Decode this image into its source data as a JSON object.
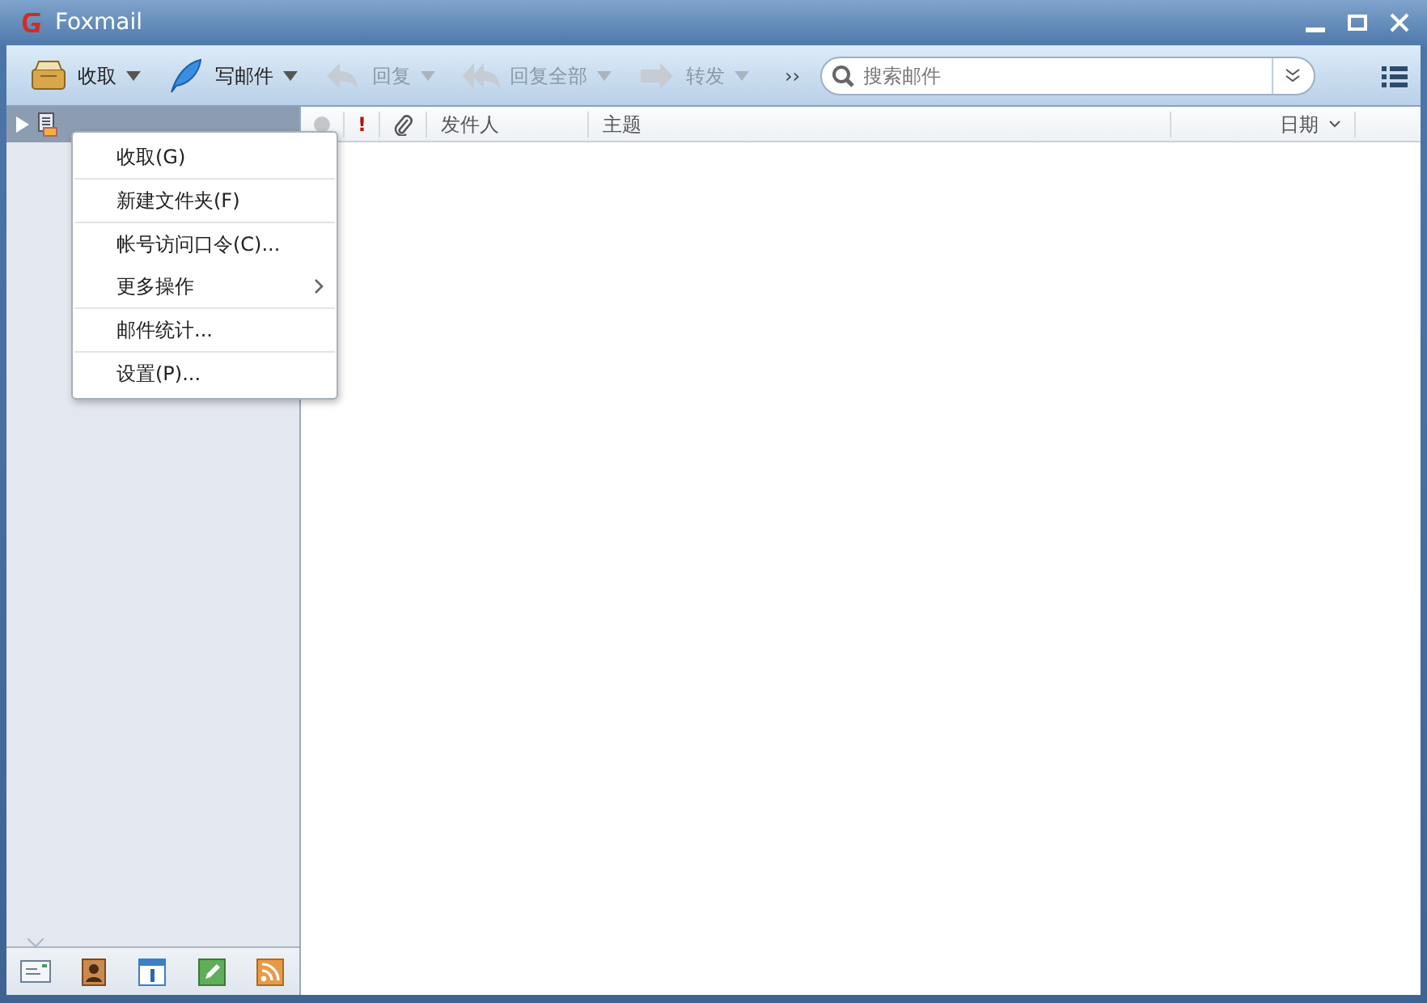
{
  "window": {
    "title": "Foxmail"
  },
  "toolbar": {
    "buttons": [
      {
        "kind": "inbox",
        "label": "收取",
        "disabled": false
      },
      {
        "kind": "compose",
        "label": "写邮件",
        "disabled": false
      },
      {
        "kind": "reply",
        "label": "回复",
        "disabled": true
      },
      {
        "kind": "replyall",
        "label": "回复全部",
        "disabled": true
      },
      {
        "kind": "forward",
        "label": "转发",
        "disabled": true
      }
    ],
    "overflow": "››",
    "search": {
      "placeholder": "搜索邮件"
    }
  },
  "mail_list": {
    "columns": [
      {
        "kind": "read"
      },
      {
        "kind": "priority",
        "label": "!"
      },
      {
        "kind": "attachment"
      },
      {
        "kind": "text",
        "label": "发件人"
      },
      {
        "kind": "text",
        "label": "主题"
      },
      {
        "kind": "date",
        "label": "日期"
      }
    ]
  },
  "context_menu": [
    {
      "label": "收取(G)",
      "submenu": false,
      "separator_after": true
    },
    {
      "label": "新建文件夹(F)",
      "submenu": false,
      "separator_after": true
    },
    {
      "label": "帐号访问口令(C)...",
      "submenu": false,
      "separator_after": false
    },
    {
      "label": "更多操作",
      "submenu": true,
      "separator_after": true
    },
    {
      "label": "邮件统计...",
      "submenu": false,
      "separator_after": true
    },
    {
      "label": "设置(P)...",
      "submenu": false,
      "separator_after": false
    }
  ],
  "bottom_nav": [
    {
      "kind": "mail",
      "selected": true
    },
    {
      "kind": "contacts",
      "selected": false
    },
    {
      "kind": "calendar",
      "selected": false
    },
    {
      "kind": "notes",
      "selected": false
    },
    {
      "kind": "feeds",
      "selected": false
    }
  ]
}
